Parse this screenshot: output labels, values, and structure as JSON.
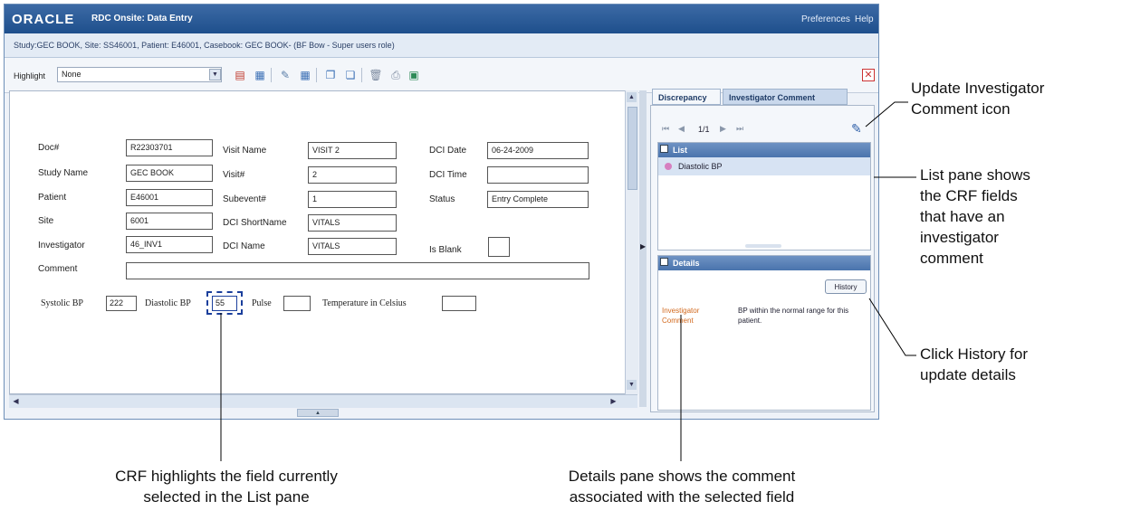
{
  "window": {
    "logo": "ORACLE",
    "title": "RDC Onsite: Data Entry",
    "links": [
      "Preferences",
      "Help"
    ],
    "context": "Study:GEC BOOK, Site: SS46001, Patient: E46001, Casebook: GEC BOOK- (BF Bow - Super users role)"
  },
  "toolbar": {
    "highlight_label": "Highlight",
    "highlight_value": "None"
  },
  "crf": {
    "doc_label": "Doc#",
    "doc_value": "R22303701",
    "study_label": "Study Name",
    "study_value": "GEC BOOK",
    "patient_label": "Patient",
    "patient_value": "E46001",
    "site_label": "Site",
    "site_value": "6001",
    "investigator_label": "Investigator",
    "investigator_value": "46_INV1",
    "comment_label": "Comment",
    "comment_value": "",
    "visit_name_label": "Visit Name",
    "visit_name_value": "VISIT 2",
    "visit_num_label": "Visit#",
    "visit_num_value": "2",
    "subevent_label": "Subevent#",
    "subevent_value": "1",
    "dci_short_label": "DCI ShortName",
    "dci_short_value": "VITALS",
    "dci_name_label": "DCI Name",
    "dci_name_value": "VITALS",
    "dci_date_label": "DCI Date",
    "dci_date_value": "06-24-2009",
    "dci_time_label": "DCI Time",
    "dci_time_value": "",
    "status_label": "Status",
    "status_value": "Entry Complete",
    "is_blank_label": "Is Blank",
    "is_blank_value": "",
    "systolic_label": "Systolic BP",
    "systolic_value": "222",
    "diastolic_label": "Diastolic BP",
    "diastolic_value": "55",
    "pulse_label": "Pulse",
    "pulse_value": "",
    "temp_label": "Temperature in Celsius",
    "temp_value": ""
  },
  "right": {
    "tab_discrepancy": "Discrepancy",
    "tab_investigator": "Investigator Comment",
    "page_indicator": "1/1",
    "list_header": "List",
    "list_item": "Diastolic BP",
    "details_header": "Details",
    "history_button": "History",
    "detail_label": "Investigator Comment",
    "detail_text": "BP within the normal range for this patient."
  },
  "annotations": {
    "update_icon": [
      "Update Investigator",
      "Comment icon"
    ],
    "list_pane": [
      "List pane shows",
      "the CRF fields",
      "that have an",
      "investigator",
      "comment"
    ],
    "history": [
      "Click History for",
      "update details"
    ],
    "crf_highlight": [
      "CRF highlights the field currently",
      "selected in the List pane"
    ],
    "details_pane": [
      "Details pane shows the comment",
      "associated with the selected field"
    ]
  },
  "colors": {
    "titlebar": "#1e4f8c",
    "section_header": "#4a74ad",
    "detail_label": "#d2691e",
    "list_dot": "#d67fc0",
    "highlight_field": "#1b3f9c"
  }
}
